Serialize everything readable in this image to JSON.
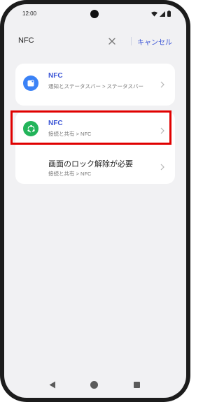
{
  "status_bar": {
    "time": "12:00"
  },
  "search": {
    "query": "NFC",
    "cancel_label": "キャンセル"
  },
  "results_group1": {
    "item": {
      "title": "NFC",
      "subtitle": "通知とステータスバー > ステータスバー",
      "icon": "app-window-icon",
      "icon_color": "#3b82f6"
    }
  },
  "results_group2": {
    "items": [
      {
        "title": "NFC",
        "subtitle": "接続と共有 > NFC",
        "icon": "share-icon",
        "icon_color": "#22b45a",
        "highlighted": true
      },
      {
        "title": "画面のロック解除が必要",
        "subtitle": "接続と共有 > NFC"
      }
    ]
  },
  "colors": {
    "accent": "#3b55d6",
    "highlight_border": "#e00000",
    "background": "#f1f1f3"
  }
}
